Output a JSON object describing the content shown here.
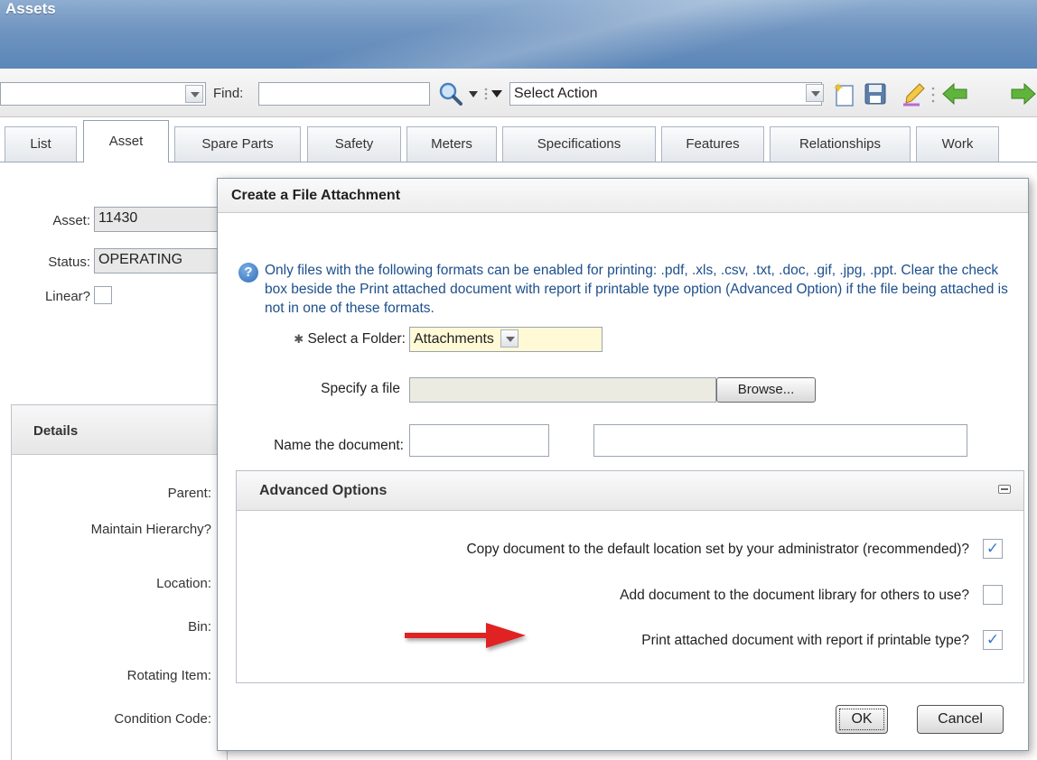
{
  "app": {
    "title": "Assets"
  },
  "toolbar": {
    "find_label": "Find:",
    "find_value": "",
    "action_select": "Select Action",
    "icons": [
      "search-icon",
      "new-record-icon",
      "save-icon",
      "clear-changes-icon",
      "previous-record-icon",
      "next-record-icon"
    ]
  },
  "tabs": [
    {
      "label": "List"
    },
    {
      "label": "Asset",
      "active": true
    },
    {
      "label": "Spare Parts"
    },
    {
      "label": "Safety"
    },
    {
      "label": "Meters"
    },
    {
      "label": "Specifications"
    },
    {
      "label": "Features"
    },
    {
      "label": "Relationships"
    },
    {
      "label": "Work"
    }
  ],
  "form": {
    "asset_label": "Asset:",
    "asset_value": "11430",
    "status_label": "Status:",
    "status_value": "OPERATING",
    "linear_label": "Linear?",
    "details_title": "Details",
    "fields": [
      "Parent:",
      "Maintain Hierarchy?",
      "Location:",
      "Bin:",
      "Rotating Item:",
      "Condition Code:"
    ]
  },
  "dialog": {
    "title": "Create a File Attachment",
    "info": "Only files with the following formats can be enabled for printing: .pdf, .xls, .csv, .txt, .doc, .gif, .jpg, .ppt. Clear the check box beside the Print attached document with report if printable type option (Advanced Option) if the file being attached is not in one of these formats.",
    "folder_label": "Select a Folder:",
    "folder_value": "Attachments",
    "file_label": "Specify a file",
    "browse_label": "Browse...",
    "name_label": "Name the document:",
    "advanced": {
      "title": "Advanced Options",
      "options": [
        {
          "label": "Copy document to the default location set by your administrator (recommended)?",
          "checked": true
        },
        {
          "label": "Add document to the document library for others to use?",
          "checked": false
        },
        {
          "label": "Print attached document with report if printable type?",
          "checked": true
        }
      ]
    },
    "ok_label": "OK",
    "cancel_label": "Cancel"
  },
  "colors": {
    "accent": "#5b86b8",
    "info_text": "#1d4f8c",
    "arrow": "#e02020",
    "checkmark": "#3a78c9"
  }
}
